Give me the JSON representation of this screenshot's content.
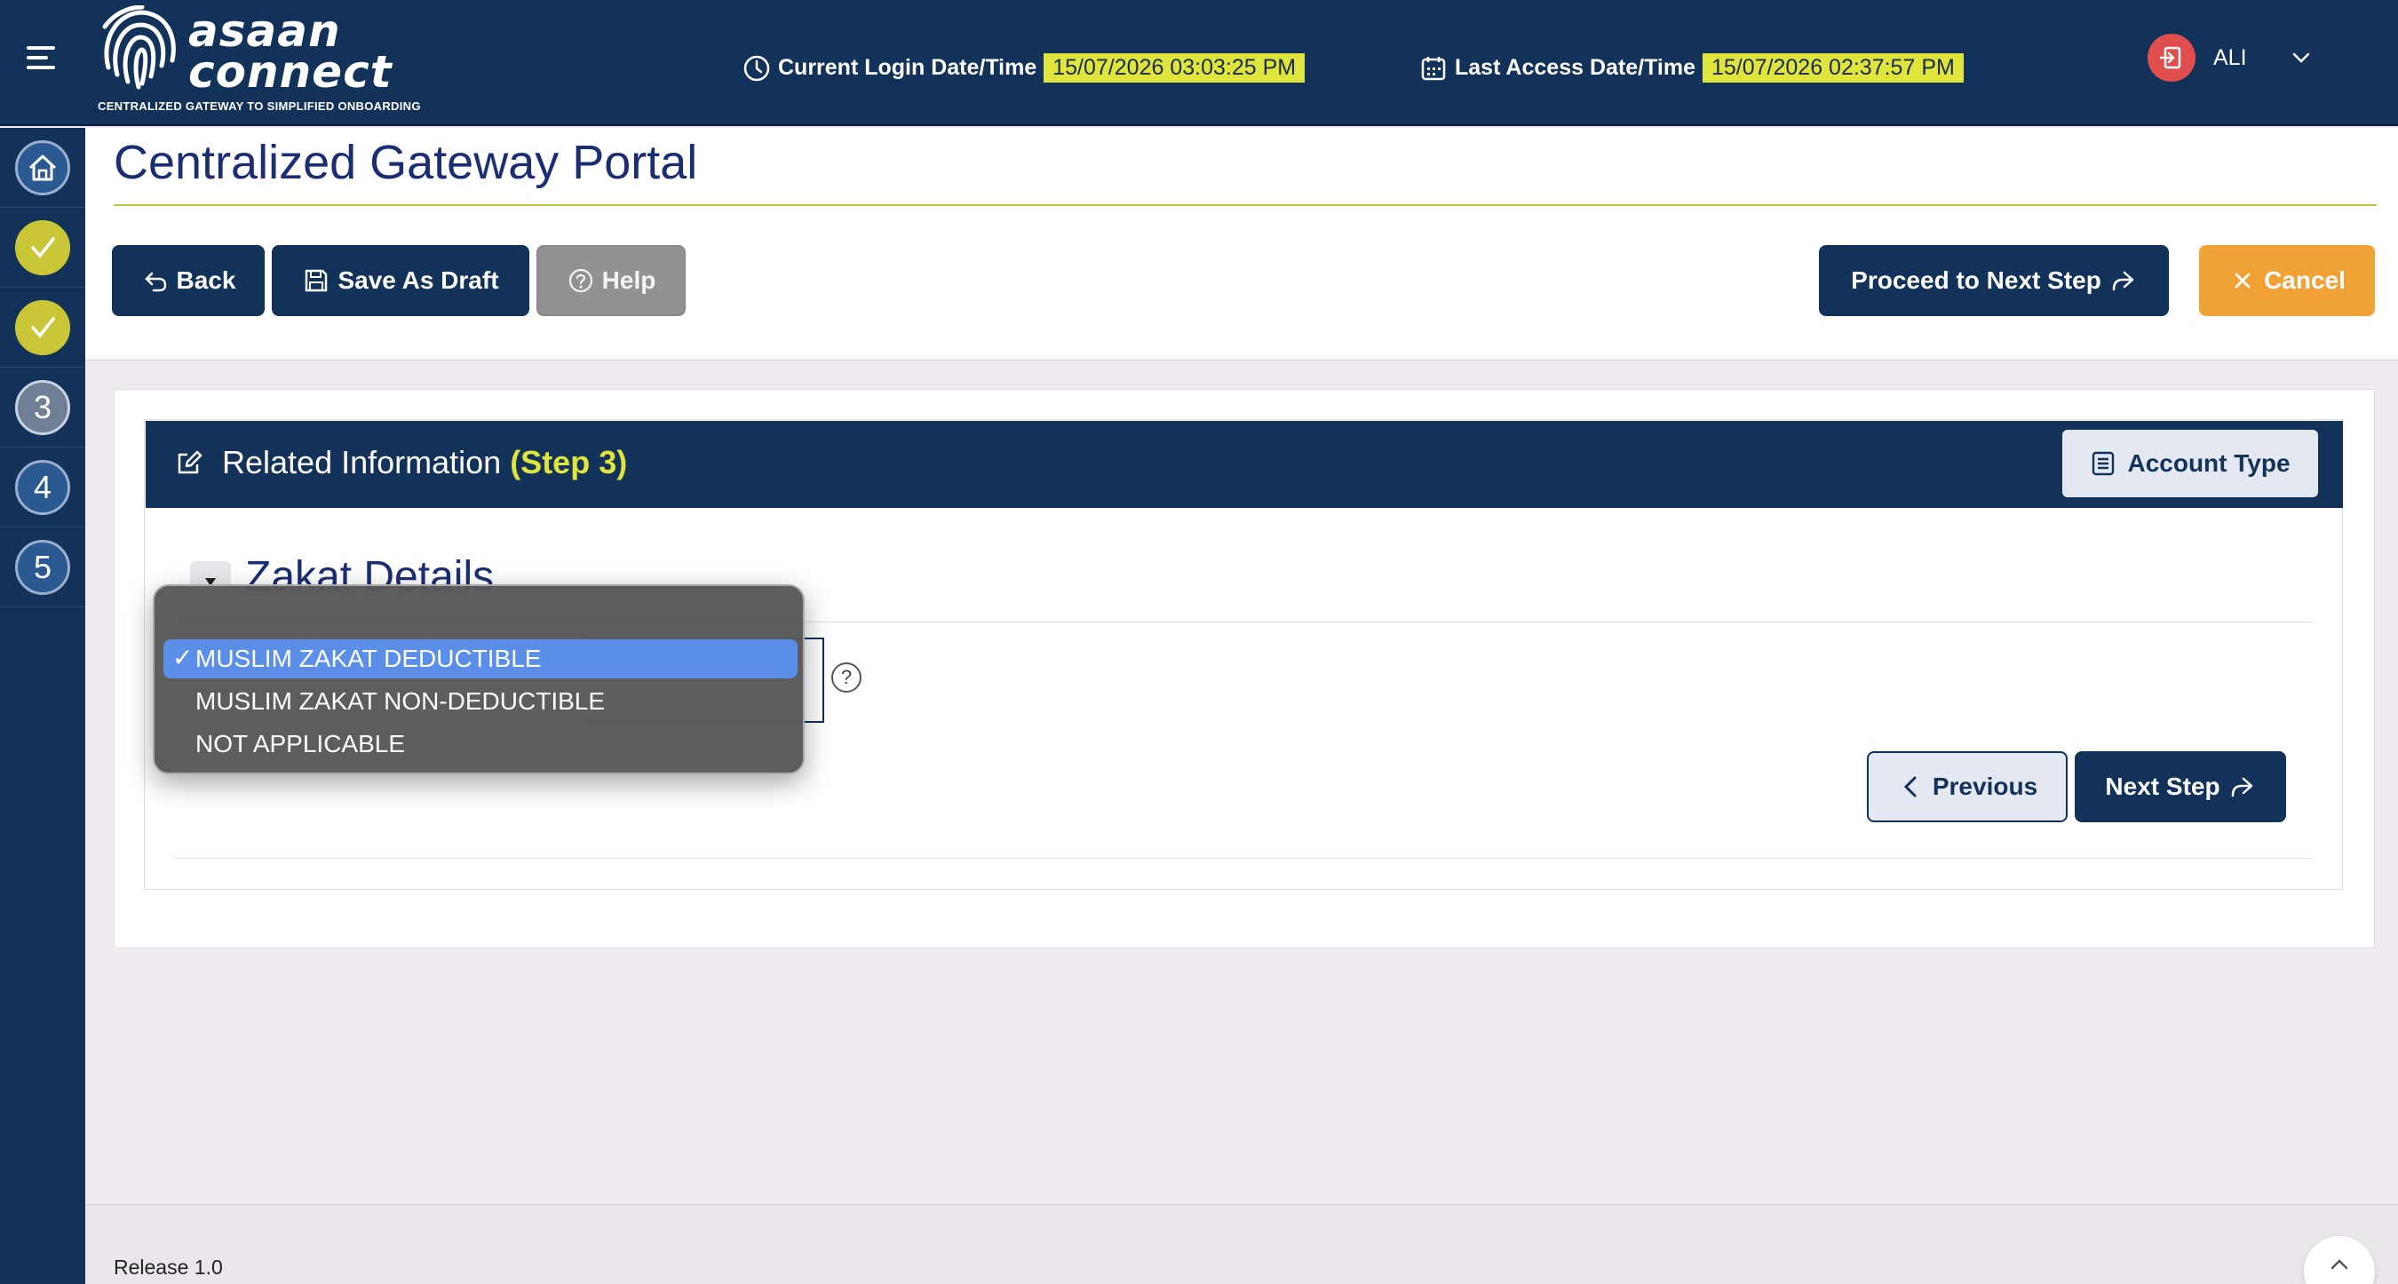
{
  "header": {
    "logo_word_1": "asaan",
    "logo_word_2": "connect",
    "logo_tagline": "CENTRALIZED GATEWAY TO SIMPLIFIED ONBOARDING",
    "login_label": "Current Login Date/Time",
    "login_value": "15/07/2026 03:03:25 PM",
    "access_label": "Last Access Date/Time",
    "access_value": "15/07/2026 02:37:57 PM",
    "user_name": "ALI"
  },
  "sidebar": {
    "steps": [
      {
        "label": "",
        "state": "home",
        "icon": "home-icon"
      },
      {
        "label": "",
        "state": "done",
        "icon": "check-icon"
      },
      {
        "label": "",
        "state": "done",
        "icon": "check-icon"
      },
      {
        "label": "3",
        "state": "current"
      },
      {
        "label": "4",
        "state": "todo"
      },
      {
        "label": "5",
        "state": "todo"
      }
    ]
  },
  "page": {
    "title": "Centralized Gateway Portal"
  },
  "toolbar": {
    "back_label": "Back",
    "save_draft_label": "Save As Draft",
    "help_label": "Help",
    "proceed_label": "Proceed to Next Step",
    "cancel_label": "Cancel"
  },
  "panel": {
    "title": "Related Information",
    "step": "(Step 3)",
    "account_type_label": "Account Type",
    "section_title": "Zakat Details",
    "previous_label": "Previous",
    "next_label": "Next Step"
  },
  "dropdown": {
    "options": [
      {
        "label": "MUSLIM ZAKAT DEDUCTIBLE",
        "selected": true
      },
      {
        "label": "MUSLIM ZAKAT NON-DEDUCTIBLE",
        "selected": false
      },
      {
        "label": "NOT APPLICABLE",
        "selected": false
      }
    ],
    "check_mark": "✓"
  },
  "footer": {
    "release": "Release 1.0"
  },
  "colors": {
    "navy": "#13325a",
    "highlight_yellow": "#dfe53c",
    "done_green": "#c9c637",
    "cancel_orange": "#f0a235",
    "selection_blue": "#5b8ee6"
  }
}
